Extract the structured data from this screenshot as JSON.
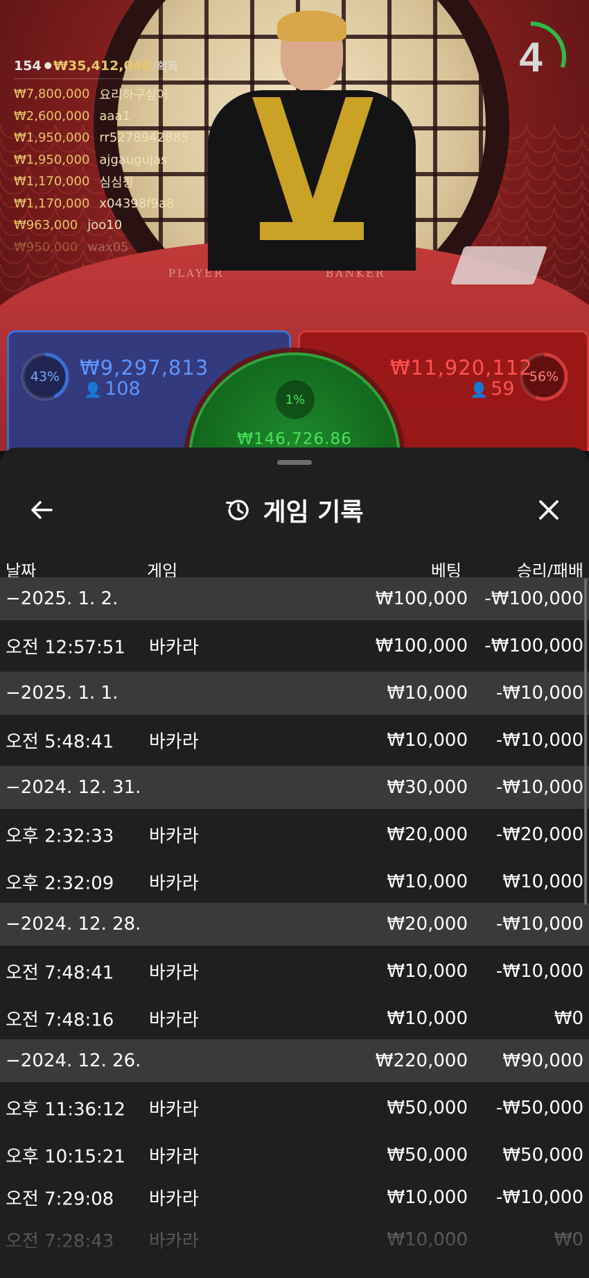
{
  "stream": {
    "table_labels": {
      "player": "PLAYER",
      "banker": "BANKER"
    },
    "timer": {
      "value": "4",
      "progress": 0.3,
      "color": "#2fb84a"
    },
    "winners": {
      "count": "154",
      "total": "₩35,412,040",
      "suffix": "획득",
      "list": [
        {
          "amount": "₩7,800,000",
          "user": "요리하구싶어"
        },
        {
          "amount": "₩2,600,000",
          "user": "aaa1"
        },
        {
          "amount": "₩1,950,000",
          "user": "rr5278942885"
        },
        {
          "amount": "₩1,950,000",
          "user": "ajgaugujas"
        },
        {
          "amount": "₩1,170,000",
          "user": "심심핑"
        },
        {
          "amount": "₩1,170,000",
          "user": "x04398f9a8"
        },
        {
          "amount": "₩963,000",
          "user": "joo10"
        },
        {
          "amount": "₩950,000",
          "user": "wax05"
        }
      ]
    },
    "player_bet": {
      "percent": "43%",
      "percent_value": 0.43,
      "amount": "₩9,297,813",
      "players": "108",
      "color": "#3b6fd4"
    },
    "banker_bet": {
      "percent": "56%",
      "percent_value": 0.56,
      "amount": "₩11,920,112",
      "players": "59",
      "color": "#d23b3b"
    },
    "tie_bet": {
      "percent": "1%",
      "amount": "₩146,726.86",
      "color": "#2ea53a"
    }
  },
  "history": {
    "title": "게임 기록",
    "icons": {
      "back": "back-arrow-icon",
      "history": "history-clock-icon",
      "close": "close-icon"
    },
    "columns": {
      "date": "날짜",
      "game": "게임",
      "bet": "베팅",
      "winloss": "승리/패배"
    },
    "groups": [
      {
        "date": "−2025. 1. 2.",
        "bet": "₩100,000",
        "result": "-₩100,000",
        "items": [
          {
            "time": "오전 12:57:51",
            "game": "바카라",
            "bet": "₩100,000",
            "result": "-₩100,000"
          }
        ]
      },
      {
        "date": "−2025. 1. 1.",
        "bet": "₩10,000",
        "result": "-₩10,000",
        "items": [
          {
            "time": "오전 5:48:41",
            "game": "바카라",
            "bet": "₩10,000",
            "result": "-₩10,000"
          }
        ]
      },
      {
        "date": "−2024. 12. 31.",
        "bet": "₩30,000",
        "result": "-₩10,000",
        "items": [
          {
            "time": "오후 2:32:33",
            "game": "바카라",
            "bet": "₩20,000",
            "result": "-₩20,000"
          },
          {
            "time": "오후 2:32:09",
            "game": "바카라",
            "bet": "₩10,000",
            "result": "₩10,000"
          }
        ]
      },
      {
        "date": "−2024. 12. 28.",
        "bet": "₩20,000",
        "result": "-₩10,000",
        "items": [
          {
            "time": "오전 7:48:41",
            "game": "바카라",
            "bet": "₩10,000",
            "result": "-₩10,000"
          },
          {
            "time": "오전 7:48:16",
            "game": "바카라",
            "bet": "₩10,000",
            "result": "₩0"
          }
        ]
      },
      {
        "date": "−2024. 12. 26.",
        "bet": "₩220,000",
        "result": "₩90,000",
        "items": [
          {
            "time": "오후 11:36:12",
            "game": "바카라",
            "bet": "₩50,000",
            "result": "-₩50,000"
          },
          {
            "time": "오후 10:15:21",
            "game": "바카라",
            "bet": "₩50,000",
            "result": "₩50,000"
          },
          {
            "time": "오전 7:29:08",
            "game": "바카라",
            "bet": "₩10,000",
            "result": "-₩10,000"
          },
          {
            "time": "오전 7:28:43",
            "game": "바카라",
            "bet": "₩10,000",
            "result": "₩0"
          }
        ]
      }
    ]
  }
}
